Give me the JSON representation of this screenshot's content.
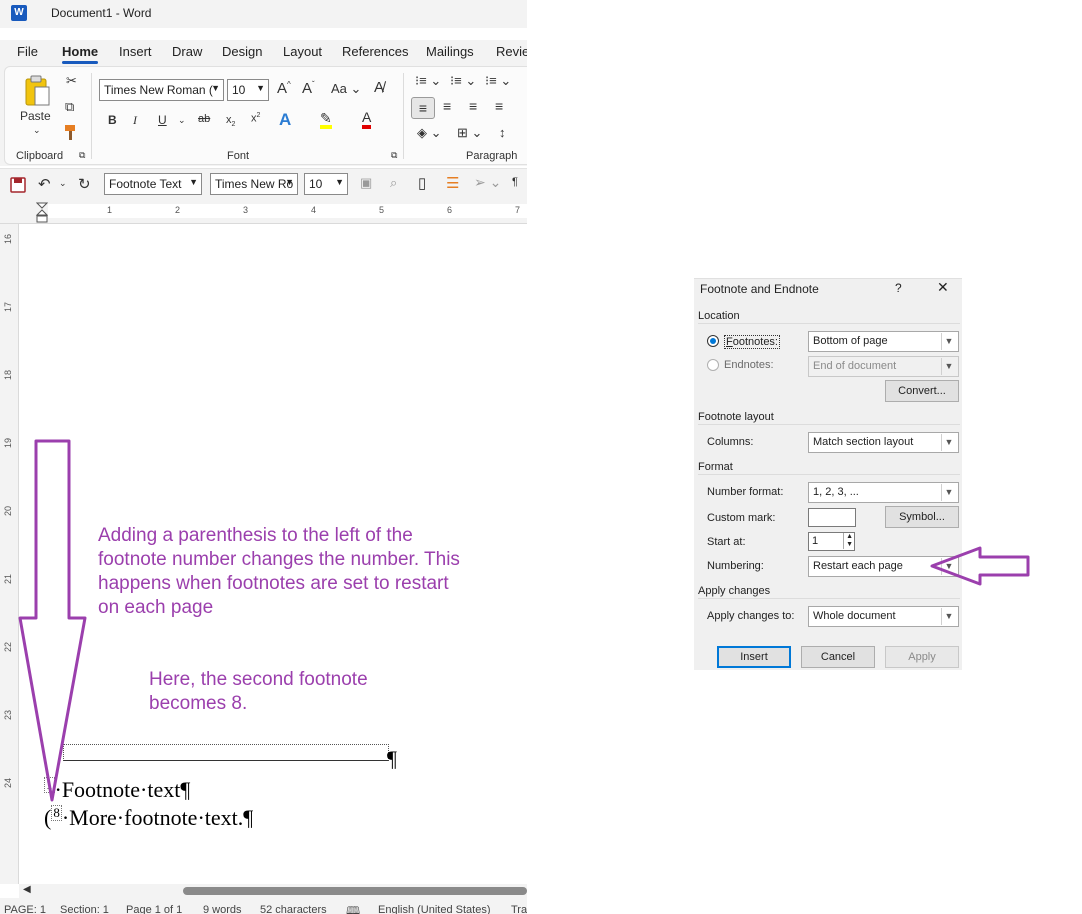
{
  "window": {
    "app_icon": "W",
    "title": "Document1  -  Word"
  },
  "tabs": [
    "File",
    "Home",
    "Insert",
    "Draw",
    "Design",
    "Layout",
    "References",
    "Mailings",
    "Revie"
  ],
  "active_tab": "Home",
  "ribbon": {
    "clipboard": {
      "paste_label": "Paste",
      "group_label": "Clipboard"
    },
    "font": {
      "font_name": "Times New Roman (",
      "font_size": "10",
      "group_label": "Font"
    },
    "paragraph": {
      "group_label": "Paragraph"
    }
  },
  "qat": {
    "style": "Footnote Text",
    "font": "Times New Ro",
    "size": "10"
  },
  "ruler_h_numbers": [
    "1",
    "2",
    "3",
    "4",
    "5",
    "6",
    "7"
  ],
  "ruler_v_numbers": [
    "16",
    "17",
    "18",
    "19",
    "20",
    "21",
    "22",
    "23",
    "24"
  ],
  "document": {
    "annotation_1": "Adding a parenthesis to the left of the footnote number changes the number. This happens when footnotes are set to restart on each page",
    "annotation_2": "Here, the second footnote becomes 8.",
    "footnote_1_number": "1",
    "footnote_1_text": "·Footnote·text¶",
    "footnote_2_prefix": "(",
    "footnote_2_number": "8",
    "footnote_2_text": "·More·footnote·text.¶",
    "separator_pilcrow": "¶"
  },
  "status": {
    "page": "PAGE: 1",
    "section": "Section: 1",
    "page_of": "Page 1 of 1",
    "words": "9 words",
    "chars": "52 characters",
    "lang": "English (United States)",
    "track": "Tra"
  },
  "dialog": {
    "title": "Footnote and Endnote",
    "help": "?",
    "close": "✕",
    "location_label": "Location",
    "footnotes_label": "Footnotes:",
    "footnotes_value": "Bottom of page",
    "endnotes_label": "Endnotes:",
    "endnotes_value": "End of document",
    "convert_button": "Convert...",
    "layout_label": "Footnote layout",
    "columns_label": "Columns:",
    "columns_value": "Match section layout",
    "format_label": "Format",
    "number_format_label": "Number format:",
    "number_format_value": "1, 2, 3, ...",
    "custom_mark_label": "Custom mark:",
    "custom_mark_value": "",
    "symbol_button": "Symbol...",
    "start_at_label": "Start at:",
    "start_at_value": "1",
    "numbering_label": "Numbering:",
    "numbering_value": "Restart each page",
    "apply_changes_label": "Apply changes",
    "apply_to_label": "Apply changes to:",
    "apply_to_value": "Whole document",
    "insert_button": "Insert",
    "cancel_button": "Cancel",
    "apply_button": "Apply"
  },
  "colors": {
    "annotation": "#9b3fad",
    "accent": "#185abd",
    "dialog_focus": "#0078d7"
  }
}
